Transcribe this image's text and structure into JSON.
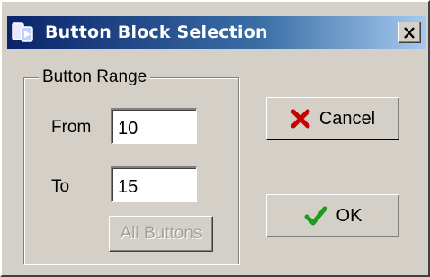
{
  "window": {
    "title": "Button Block Selection",
    "title_icon": "app-icon",
    "close_icon": "close-icon"
  },
  "group": {
    "label": "Button Range",
    "from_label": "From",
    "from_value": "10",
    "to_label": "To",
    "to_value": "15",
    "all_buttons_label": "All Buttons"
  },
  "actions": {
    "cancel_label": "Cancel",
    "cancel_icon": "x-icon",
    "ok_label": "OK",
    "ok_icon": "checkmark-icon"
  },
  "colors": {
    "titlebar_start": "#0a246a",
    "titlebar_end": "#a6caf0",
    "face": "#d4d0c8",
    "cancel_red": "#cc0000",
    "ok_green": "#1f9a1f"
  }
}
